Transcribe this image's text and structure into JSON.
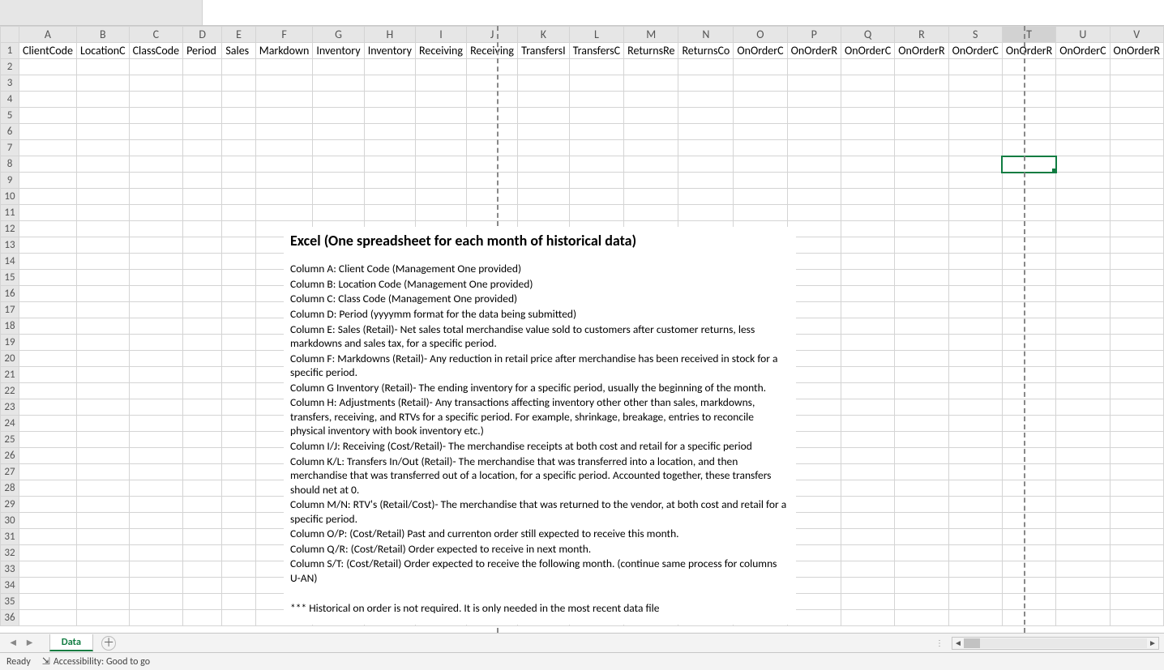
{
  "columns": [
    "A",
    "B",
    "C",
    "D",
    "E",
    "F",
    "G",
    "H",
    "I",
    "J",
    "K",
    "L",
    "M",
    "N",
    "O",
    "P",
    "Q",
    "R",
    "S",
    "T",
    "U",
    "V"
  ],
  "headers": {
    "A": "ClientCode",
    "B": "LocationC",
    "C": "ClassCode",
    "D": "Period",
    "E": "Sales",
    "F": "Markdown",
    "G": "Inventory",
    "H": "Inventory",
    "I": "Receiving",
    "J": "Receiving",
    "K": "TransfersI",
    "L": "TransfersC",
    "M": "ReturnsRe",
    "N": "ReturnsCo",
    "O": "OnOrderC",
    "P": "OnOrderR",
    "Q": "OnOrderC",
    "R": "OnOrderR",
    "S": "OnOrderC",
    "T": "OnOrderR",
    "U": "OnOrderC",
    "V": "OnOrderR"
  },
  "selected_cell": "T8",
  "selected_column": "T",
  "row_count": 36,
  "page_break_after_cols": [
    "I",
    "S"
  ],
  "sheet_tabs": {
    "active": "Data"
  },
  "status": {
    "ready": "Ready",
    "accessibility": "Accessibility: Good to go"
  },
  "overlay": {
    "title": "Excel (One spreadsheet for each month of historical data)",
    "lines": [
      "Column A: Client Code (Management One provided)",
      "Column B: Location Code (Management One provided)",
      "Column C: Class Code (Management One provided)",
      "Column D: Period (yyyymm format for the data being submitted)",
      "Column E:  Sales (Retail)-   Net sales total merchandise value sold to customers after customer returns, less markdowns and sales tax, for a specific period.",
      "Column F:  Markdowns (Retail)-   Any reduction in retail price after merchandise has been received in stock for a specific period.",
      "Column G  Inventory (Retail)-   The ending inventory for a specific period, usually the beginning of the month.",
      "Column H:  Adjustments (Retail)-   Any transactions affecting inventory other other than sales, markdowns, transfers, receiving, and RTVs for a specific period. For example, shrinkage, breakage, entries to reconcile physical inventory with book inventory etc.)",
      "Column I/J:  Receiving (Cost/Retail)-  The merchandise receipts at both cost and retail for a specific period",
      "Column K/L:  Transfers In/Out (Retail)-   The merchandise that was transferred into a location, and then merchandise that was transferred out of a location, for a specific period. Accounted together, these transfers should net at 0.",
      "Column M/N:  RTV's (Retail/Cost)-  The merchandise that was returned to the vendor, at both cost and retail for a specific period.",
      "Column O/P: (Cost/Retail)  Past and currenton order still expected to receive this month.",
      "Column Q/R: (Cost/Retail) Order expected to receive in next month.",
      "Column S/T:  (Cost/Retail)  Order expected to receive the following month. (continue same process for columns U-AN)",
      "",
      "*** Historical on order is not required.  It is only needed in the most recent data file"
    ]
  }
}
